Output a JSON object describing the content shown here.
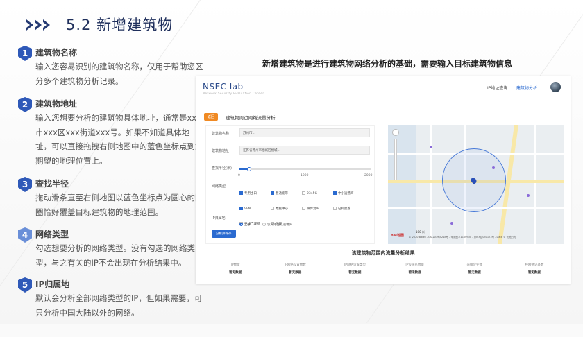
{
  "header": {
    "title": "5.2 新增建筑物"
  },
  "steps": [
    {
      "num": "1",
      "title": "建筑物名称",
      "body": "输入您容易识别的建筑物名称，仅用于帮助您区分多个建筑物分析记录。"
    },
    {
      "num": "2",
      "title": "建筑物地址",
      "body": "输入您想要分析的建筑物具体地址，通常是xxx市xxx区xxx街道xxx号。如果不知道具体地址，可以直接拖拽右侧地图中的蓝色坐标点到您期望的地理位置上。"
    },
    {
      "num": "3",
      "title": "查找半径",
      "body": "拖动滑条直至右侧地图以蓝色坐标点为圆心的圆圈恰好覆盖目标建筑物的地理范围。"
    },
    {
      "num": "4",
      "title": "网络类型",
      "body": "勾选想要分析的网络类型。没有勾选的网络类型，与之有关的IP不会出现在分析结果中。"
    },
    {
      "num": "5",
      "title": "IP归属地",
      "body": "默认会分析全部网络类型的IP，但如果需要，可只分析中国大陆以外的网络。"
    }
  ],
  "headline": "新增建筑物是进行建筑物网络分析的基础，需要输入目标建筑物信息",
  "app": {
    "logo": "NSEC lab",
    "logo_sub": "Network Security Evaluation Center",
    "nav": [
      "IP地址查询",
      "建筑物分析"
    ],
    "tag": "返回",
    "page_title": "建筑物周边网络流量分析",
    "form": {
      "name_label": "建筑物名称",
      "name_value": "苏州市...",
      "addr_label": "建筑物地址",
      "addr_value": "江苏省苏州市相城区相城...",
      "radius_label": "查找半径(米)",
      "radius_ticks": [
        "0",
        "1000",
        "2000"
      ],
      "radius_value": 150,
      "radius_max": 2000,
      "nettype_label": "网络类型",
      "nettypes": [
        {
          "label": "专用出口",
          "checked": true
        },
        {
          "label": "普通宽带",
          "checked": true
        },
        {
          "label": "2345G",
          "checked": false
        },
        {
          "label": "中小运营商",
          "checked": true
        },
        {
          "label": "VPN",
          "checked": true
        },
        {
          "label": "数据中心",
          "checked": false
        },
        {
          "label": "媒体为IP",
          "checked": false
        },
        {
          "label": "已抑屋落",
          "checked": false
        },
        {
          "label": "无线广域网",
          "checked": false
        },
        {
          "label": "代理",
          "checked": false
        }
      ],
      "ip_label": "IP归属地",
      "ip_options": [
        {
          "label": "全部",
          "selected": true
        },
        {
          "label": "仅海港台以及境外",
          "selected": false
        }
      ],
      "submit": "分析并保存"
    },
    "map": {
      "scale": "100 米",
      "copyright": "© 2020 Baidu - GS(2019)5218号 - 甲测资字1100930 - 京ICP证030173号 - Data © 长地万方",
      "brand": "Bai地图"
    },
    "results_title": "该建筑物范围内流量分析结果",
    "results": [
      {
        "h": "IP数量",
        "v": "暂无数据"
      },
      {
        "h": "IP网络设置数数",
        "v": "暂无数据"
      },
      {
        "h": "IP网络设置类型",
        "v": "暂无数据"
      },
      {
        "h": "IP设施名数量",
        "v": "暂无数据"
      },
      {
        "h": "采样企业数",
        "v": "暂无数据"
      },
      {
        "h": "经网整记录数",
        "v": "暂无数据"
      }
    ]
  }
}
